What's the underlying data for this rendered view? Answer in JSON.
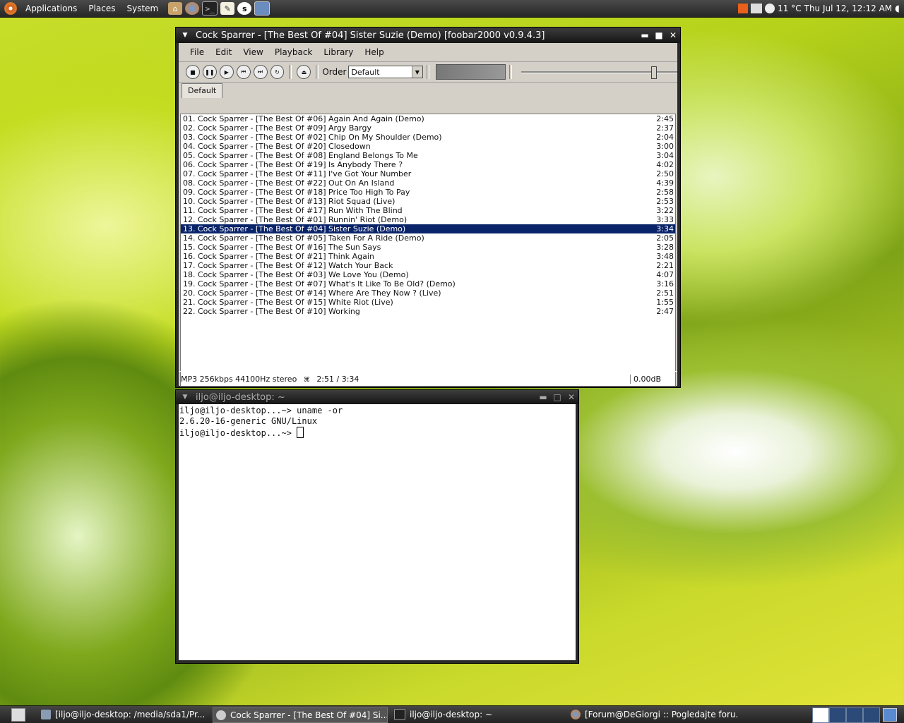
{
  "top_panel": {
    "menus": [
      "Applications",
      "Places",
      "System"
    ],
    "launchers": [
      "home-folder",
      "firefox",
      "terminal",
      "text-editor",
      "skype",
      "screenshot"
    ],
    "weather": "11 °C",
    "clock": "Thu Jul 12, 12:12 AM"
  },
  "foobar": {
    "title": "Cock Sparrer - [The Best Of #04] Sister Suzie (Demo)   [foobar2000 v0.9.4.3]",
    "menu": [
      "File",
      "Edit",
      "View",
      "Playback",
      "Library",
      "Help"
    ],
    "order_label": "Order",
    "order_value": "Default",
    "volume_fraction": 0.85,
    "tab": "Default",
    "tracks": [
      {
        "title": "01. Cock Sparrer - [The Best Of #06] Again And Again (Demo)",
        "duration": "2:45"
      },
      {
        "title": "02. Cock Sparrer - [The Best Of #09] Argy Bargy",
        "duration": "2:37"
      },
      {
        "title": "03. Cock Sparrer - [The Best Of #02] Chip On My Shoulder (Demo)",
        "duration": "2:04"
      },
      {
        "title": "04. Cock Sparrer - [The Best Of #20] Closedown",
        "duration": "3:00"
      },
      {
        "title": "05. Cock Sparrer - [The Best Of #08] England Belongs To Me",
        "duration": "3:04"
      },
      {
        "title": "06. Cock Sparrer - [The Best Of #19] Is Anybody There ?",
        "duration": "4:02"
      },
      {
        "title": "07. Cock Sparrer - [The Best Of #11] I've Got Your Number",
        "duration": "2:50"
      },
      {
        "title": "08. Cock Sparrer - [The Best Of #22] Out On An Island",
        "duration": "4:39"
      },
      {
        "title": "09. Cock Sparrer - [The Best Of #18] Price Too High To Pay",
        "duration": "2:58"
      },
      {
        "title": "10. Cock Sparrer - [The Best Of #13] Riot Squad (Live)",
        "duration": "2:53"
      },
      {
        "title": "11. Cock Sparrer - [The Best Of #17] Run With The Blind",
        "duration": "3:22"
      },
      {
        "title": "12. Cock Sparrer - [The Best Of #01] Runnin' Riot (Demo)",
        "duration": "3:33"
      },
      {
        "title": "13. Cock Sparrer - [The Best Of #04] Sister Suzie (Demo)",
        "duration": "3:34",
        "selected": true
      },
      {
        "title": "14. Cock Sparrer - [The Best Of #05] Taken For A Ride (Demo)",
        "duration": "2:05"
      },
      {
        "title": "15. Cock Sparrer - [The Best Of #16] The Sun Says",
        "duration": "3:28"
      },
      {
        "title": "16. Cock Sparrer - [The Best Of #21] Think Again",
        "duration": "3:48"
      },
      {
        "title": "17. Cock Sparrer - [The Best Of #12] Watch Your Back",
        "duration": "2:21"
      },
      {
        "title": "18. Cock Sparrer - [The Best Of #03] We Love You (Demo)",
        "duration": "4:07"
      },
      {
        "title": "19. Cock Sparrer - [The Best Of #07] What's It Like To Be Old? (Demo)",
        "duration": "3:16"
      },
      {
        "title": "20. Cock Sparrer - [The Best Of #14] Where Are They Now ? (Live)",
        "duration": "2:51"
      },
      {
        "title": "21. Cock Sparrer - [The Best Of #15] White Riot (Live)",
        "duration": "1:55"
      },
      {
        "title": "22. Cock Sparrer - [The Best Of #10] Working",
        "duration": "2:47"
      }
    ],
    "status_format": "MP3 256kbps 44100Hz stereo",
    "status_time": "2:51 / 3:34",
    "status_gain": "0.00dB"
  },
  "terminal": {
    "title": "iljo@iljo-desktop: ~",
    "lines": [
      "iljo@iljo-desktop...~> uname -or",
      "2.6.20-16-generic GNU/Linux",
      "iljo@iljo-desktop...~> "
    ]
  },
  "taskbar": {
    "tasks": [
      {
        "label": "[iljo@iljo-desktop: /media/sda1/Pr...",
        "active": false
      },
      {
        "label": "Cock Sparrer - [The Best Of #04] Si...",
        "active": true
      },
      {
        "label": "iljo@iljo-desktop: ~",
        "active": false
      },
      {
        "label": "[Forum@DeGiorgi :: Pogledajte foru...",
        "active": false
      }
    ]
  },
  "colors": {
    "selection": "#0a246a",
    "panel": "#333333",
    "window_frame": "#2a2a2a"
  }
}
